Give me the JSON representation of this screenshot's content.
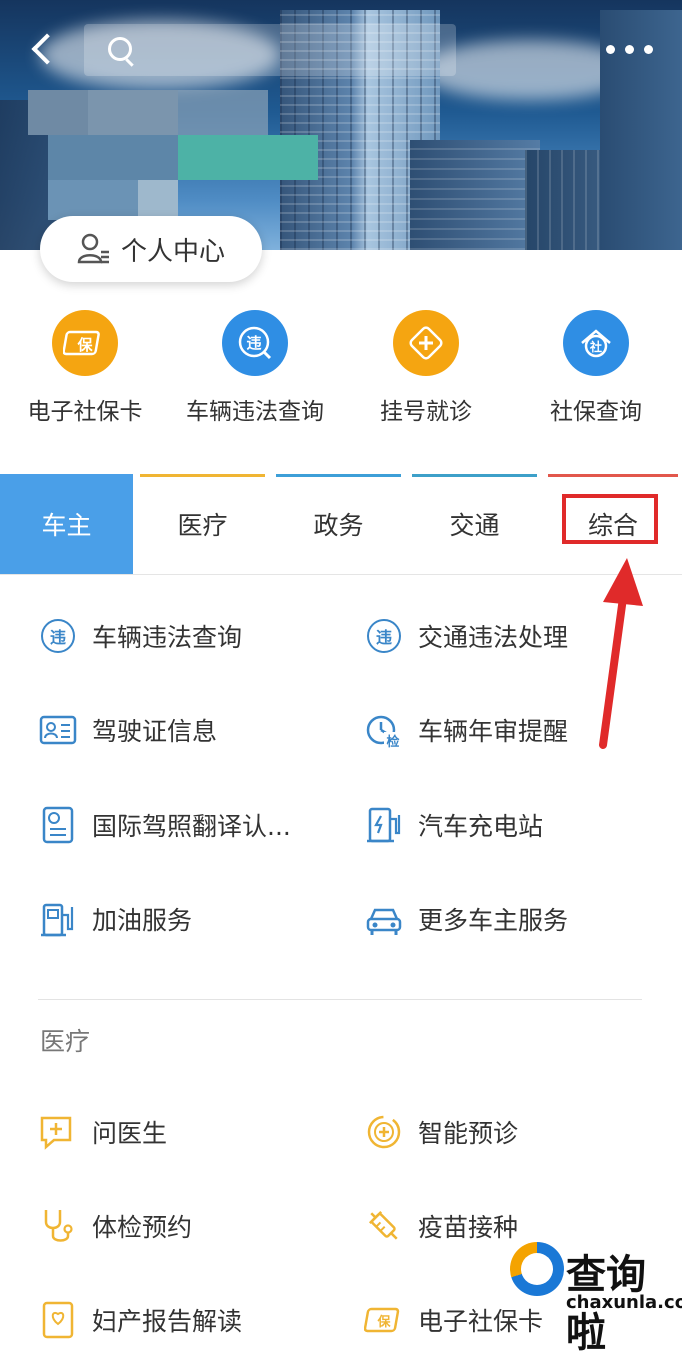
{
  "header": {
    "search_placeholder": "",
    "personal_center_label": "个人中心"
  },
  "quick_services": [
    {
      "label": "电子社保卡",
      "icon": "social-card-icon",
      "icon_text": "保",
      "color": "#f5a511"
    },
    {
      "label": "车辆违法查询",
      "icon": "violation-icon",
      "icon_text": "违",
      "color": "#2f8ee4"
    },
    {
      "label": "挂号就诊",
      "icon": "medical-cross-icon",
      "icon_text": "",
      "color": "#f5a511"
    },
    {
      "label": "社保查询",
      "icon": "social-query-icon",
      "icon_text": "社",
      "color": "#2f8ee4"
    }
  ],
  "tabs": [
    {
      "label": "车主",
      "active": true,
      "line_color": "#4a9fe8"
    },
    {
      "label": "医疗",
      "active": false,
      "line_color": "#f0b533"
    },
    {
      "label": "政务",
      "active": false,
      "line_color": "#3d9fd8"
    },
    {
      "label": "交通",
      "active": false,
      "line_color": "#3da0c9"
    },
    {
      "label": "综合",
      "active": false,
      "line_color": "#e2574c"
    }
  ],
  "car_owner_services": [
    {
      "label": "车辆违法查询",
      "icon": "violation-icon"
    },
    {
      "label": "交通违法处理",
      "icon": "violation-icon"
    },
    {
      "label": "驾驶证信息",
      "icon": "id-card-icon"
    },
    {
      "label": "车辆年审提醒",
      "icon": "annual-check-icon"
    },
    {
      "label": "国际驾照翻译认...",
      "icon": "document-icon"
    },
    {
      "label": "汽车充电站",
      "icon": "charging-station-icon"
    },
    {
      "label": "加油服务",
      "icon": "fuel-pump-icon"
    },
    {
      "label": "更多车主服务",
      "icon": "car-icon"
    }
  ],
  "medical_section": {
    "title": "医疗",
    "items": [
      {
        "label": "问医生",
        "icon": "chat-doctor-icon"
      },
      {
        "label": "智能预诊",
        "icon": "smart-diagnosis-icon"
      },
      {
        "label": "体检预约",
        "icon": "stethoscope-icon"
      },
      {
        "label": "疫苗接种",
        "icon": "syringe-icon"
      },
      {
        "label": "妇产报告解读",
        "icon": "report-icon"
      },
      {
        "label": "电子社保卡",
        "icon": "social-card-icon"
      }
    ]
  },
  "watermark": {
    "cn": "查询啦",
    "en": "chaxunla.com"
  },
  "colors": {
    "accent": "#4a9fe8",
    "blue_icon": "#3a86c8",
    "orange_icon": "#f0b533",
    "annotation_red": "#e02a2a"
  }
}
